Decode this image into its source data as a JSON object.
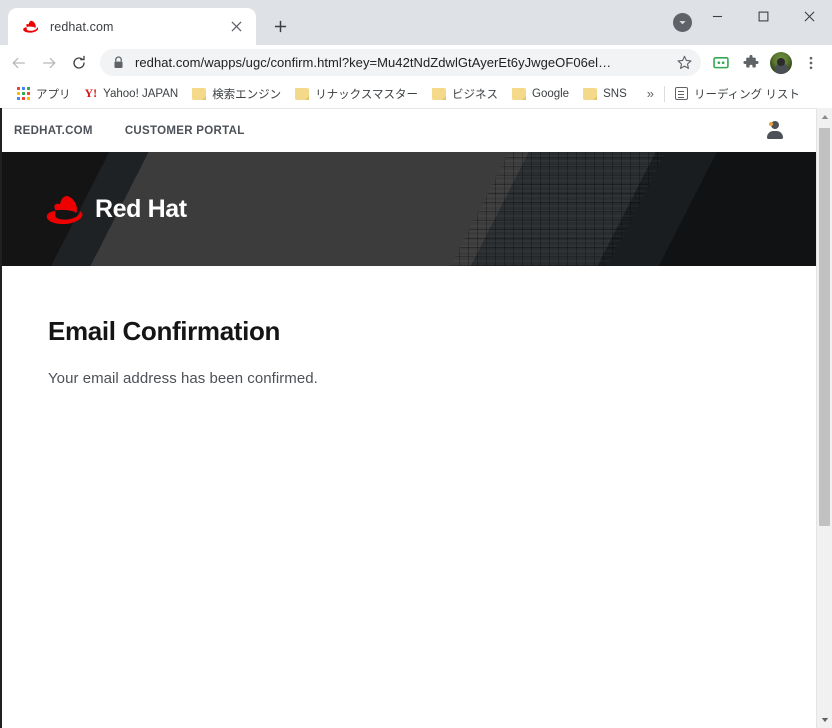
{
  "browser": {
    "tab": {
      "title": "redhat.com",
      "favicon": "redhat-fedora-icon",
      "close_label": "×"
    },
    "new_tab_label": "+",
    "window_controls": {
      "update_label": "update-chevron",
      "minimize_label": "—",
      "maximize_label": "□",
      "close_label": "✕"
    },
    "toolbar": {
      "back_label": "Back",
      "forward_label": "Forward",
      "reload_label": "Reload",
      "url": "redhat.com/wapps/ugc/confirm.html?key=Mu42tNdZdwlGtAyerEt6yJwgeOF06el…",
      "url_domain": "redhat.com",
      "url_path": "/wapps/ugc/confirm.html?key=Mu42tNdZdwlGtAyerEt6yJwgeOF06el…",
      "lock_label": "Secure",
      "star_label": "Bookmark this tab",
      "cast_label": "Cast",
      "extensions_label": "Extensions",
      "profile_label": "Profile",
      "menu_label": "Customize and control Google Chrome"
    },
    "bookmarks": {
      "items": [
        {
          "label": "アプリ",
          "icon": "apps-grid-icon"
        },
        {
          "label": "Yahoo! JAPAN",
          "icon": "yahoo-icon"
        },
        {
          "label": "検索エンジン",
          "icon": "folder-icon"
        },
        {
          "label": "リナックスマスター",
          "icon": "folder-icon"
        },
        {
          "label": "ビジネス",
          "icon": "folder-icon"
        },
        {
          "label": "Google",
          "icon": "folder-icon"
        },
        {
          "label": "SNS",
          "icon": "folder-icon"
        }
      ],
      "overflow_label": "»",
      "reading_list_label": "リーディング リスト"
    },
    "scrollbar": {
      "up_label": "▲",
      "down_label": "▼"
    }
  },
  "site": {
    "topnav": {
      "links": [
        {
          "label": "REDHAT.COM"
        },
        {
          "label": "CUSTOMER PORTAL"
        }
      ],
      "account_icon": "user-account-icon"
    },
    "hero": {
      "logo_text": "Red Hat",
      "logo_icon": "red-hat-fedora-logo"
    },
    "main": {
      "title": "Email Confirmation",
      "body": "Your email address has been confirmed."
    }
  },
  "colors": {
    "redhat_red": "#ee0000",
    "hero_dark": "#151515",
    "hero_gray": "#3c3c3c",
    "text_dark": "#151515",
    "text_muted": "#4d5258",
    "chrome_bg": "#dee1e6"
  }
}
